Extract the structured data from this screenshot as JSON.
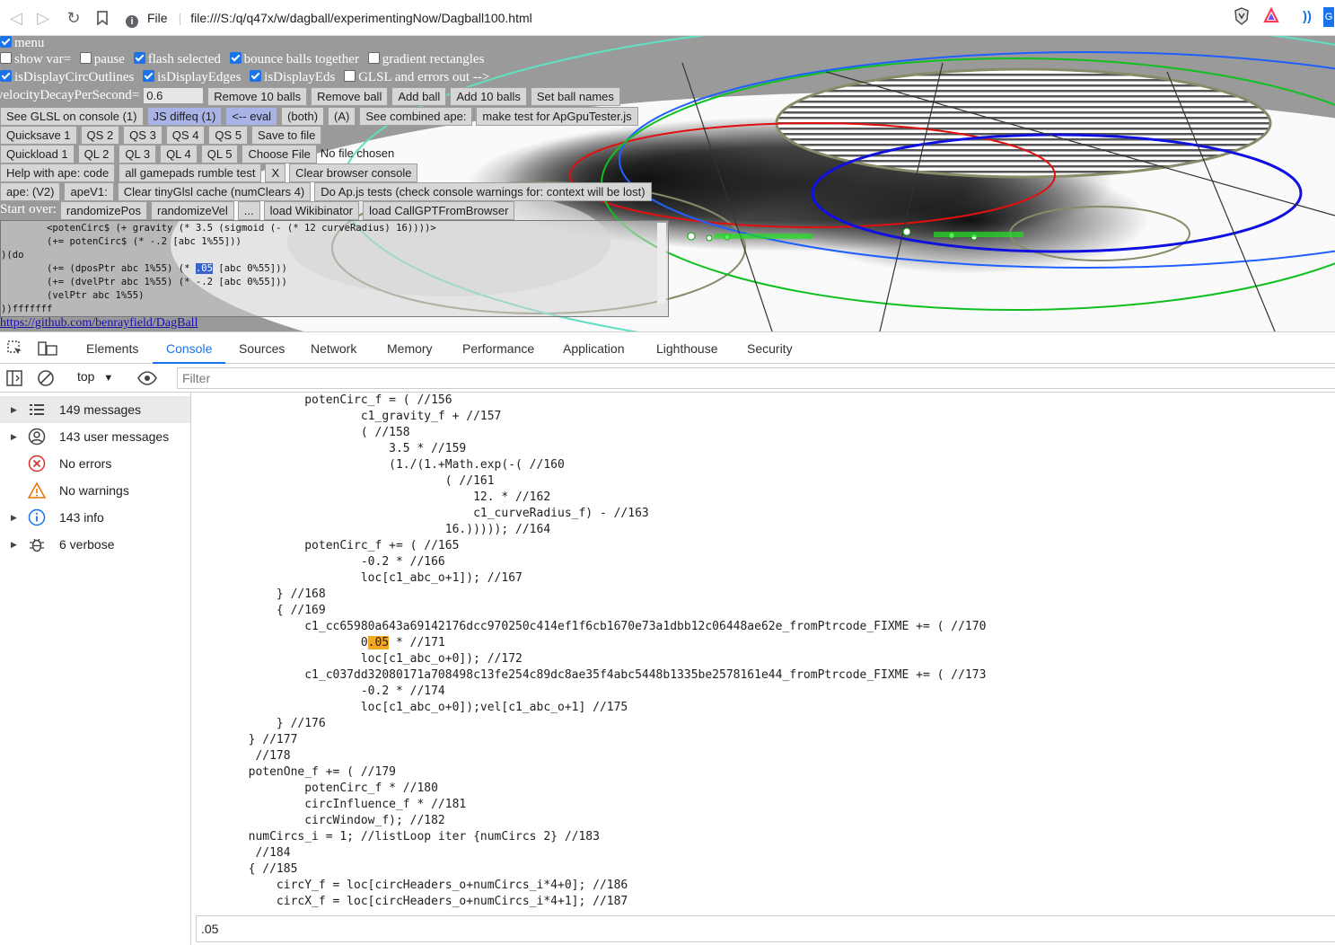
{
  "browser": {
    "url_scheme": "File",
    "url": "file:///S:/q/q47x/w/dagball/experimentingNow/Dagball100.html"
  },
  "page": {
    "checkbox_rows": [
      [
        {
          "label": "menu",
          "checked": true
        }
      ],
      [
        {
          "label": "show var=",
          "checked": false
        },
        {
          "label": "pause",
          "checked": false
        },
        {
          "label": "flash selected",
          "checked": true
        },
        {
          "label": "bounce balls together",
          "checked": true
        },
        {
          "label": "gradient rectangles",
          "checked": false
        }
      ],
      [
        {
          "label": "isDisplayCircOutlines",
          "checked": true
        },
        {
          "label": "isDisplayEdges",
          "checked": true
        },
        {
          "label": "isDisplayEds",
          "checked": true
        },
        {
          "label": "GLSL and errors out -->",
          "checked": false
        }
      ]
    ],
    "velocity_label": "velocityDecayPerSecond=",
    "velocity_value": "0.6",
    "row_velocity_buttons": [
      "Remove 10 balls",
      "Remove ball",
      "Add ball",
      "Add 10 balls",
      "Set ball names"
    ],
    "row_glsl_buttons": [
      "See GLSL on console (1)",
      "JS diffeq (1)",
      "<-- eval",
      "(both)",
      "(A)",
      "See combined ape:",
      "make test for ApGpuTester.js"
    ],
    "row_quicksave_buttons": [
      "Quicksave 1",
      "QS 2",
      "QS 3",
      "QS 4",
      "QS 5",
      "Save to file"
    ],
    "row_quickload_buttons": [
      "Quickload 1",
      "QL 2",
      "QL 3",
      "QL 4",
      "QL 5",
      "Choose File"
    ],
    "no_file_label": "No file chosen",
    "row_help_buttons": [
      "Help with ape: code",
      "all gamepads rumble test",
      "X",
      "Clear browser console"
    ],
    "row_ape_buttons": [
      "ape: (V2)",
      "apeV1:",
      "Clear tinyGlsl cache (numClears 4)",
      "Do Ap.js tests (check console warnings for: context will be lost)"
    ],
    "start_over_label": "Start over:",
    "row_start_buttons": [
      "randomizePos",
      "randomizeVel",
      "...",
      "load Wikibinator",
      "load CallGPTFromBrowser"
    ],
    "code_lines": [
      "        <potenCirc$ (+ gravity (* 3.5 (sigmoid (- (* 12 curveRadius) 16))))>",
      "        (+= potenCirc$ (* -.2 [abc 1%55]))",
      ")(do",
      "        (+= (dposPtr abc 1%55) (* ",
      "        (+= (dvelPtr abc 1%55) (* -.2 [abc 0%55]))",
      "        (velPtr abc 1%55)",
      "))fffffff"
    ],
    "code_sel_text": ".05",
    "code_after_sel": " [abc 0%55]))",
    "github_link": "https://github.com/benrayfield/DagBall"
  },
  "devtools": {
    "tabs": [
      "Elements",
      "Console",
      "Sources",
      "Network",
      "Memory",
      "Performance",
      "Application",
      "Lighthouse",
      "Security"
    ],
    "active_tab": "Console",
    "context": "top",
    "filter_placeholder": "Filter",
    "sidebar": [
      {
        "label": "149 messages",
        "icon": "list-icon",
        "expandable": true
      },
      {
        "label": "143 user messages",
        "icon": "user-icon",
        "expandable": true
      },
      {
        "label": "No errors",
        "icon": "error-icon",
        "expandable": false
      },
      {
        "label": "No warnings",
        "icon": "warning-icon",
        "expandable": false
      },
      {
        "label": "143 info",
        "icon": "info-icon",
        "expandable": true
      },
      {
        "label": "6 verbose",
        "icon": "bug-icon",
        "expandable": true
      }
    ],
    "console_lines": [
      "                potenCirc_f = ( //156",
      "                        c1_gravity_f + //157",
      "                        ( //158",
      "                            3.5 * //159",
      "                            (1./(1.+Math.exp(-( //160",
      "                                    ( //161",
      "                                        12. * //162",
      "                                        c1_curveRadius_f) - //163",
      "                                    16.))))); //164",
      "                potenCirc_f += ( //165",
      "                        -0.2 * //166",
      "                        loc[c1_abc_o+1]); //167",
      "            } //168",
      "            { //169",
      "                c1_cc65980a643a69142176dcc970250c414ef1f6cb1670e73a1dbb12c06448ae62e_fromPtrcode_FIXME += ( //170",
      "                        0.05 * //171",
      "                        loc[c1_abc_o+0]); //172",
      "                c1_c037dd32080171a708498c13fe254c89dc8ae35f4abc5448b1335be2578161e44_fromPtrcode_FIXME += ( //173",
      "                        -0.2 * //174",
      "                        loc[c1_abc_o+0]);vel[c1_abc_o+1] //175",
      "            } //176",
      "        } //177",
      "         //178",
      "        potenOne_f += ( //179",
      "                potenCirc_f * //180",
      "                circInfluence_f * //181",
      "                circWindow_f); //182",
      "        numCircs_i = 1; //listLoop iter {numCircs 2} //183",
      "         //184",
      "        { //185",
      "            circY_f = loc[circHeaders_o+numCircs_i*4+0]; //186",
      "            circX_f = loc[circHeaders_o+numCircs_i*4+1]; //187"
    ],
    "find_highlight": ".05",
    "console_input": ".05"
  }
}
